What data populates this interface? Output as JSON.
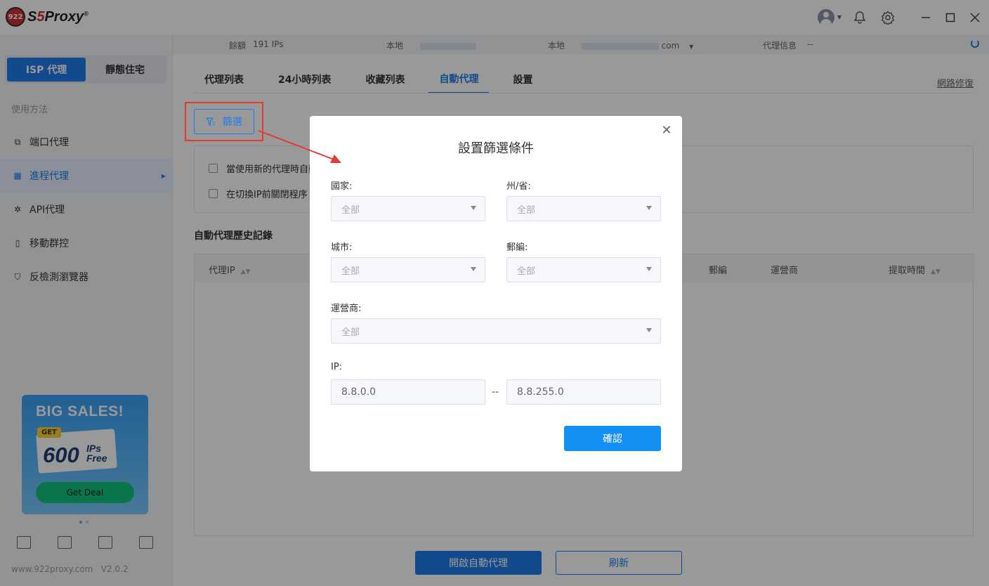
{
  "app": {
    "logo_badge": "922",
    "logo_s": "S",
    "logo_five": "5",
    "logo_rest": "Proxy",
    "logo_reg": "®"
  },
  "sidebar": {
    "type_tabs": [
      {
        "label": "ISP 代理",
        "active": true
      },
      {
        "label": "靜態住宅",
        "active": false
      }
    ],
    "section_title": "使用方法",
    "items": [
      {
        "label": "端口代理",
        "icon": "network-icon"
      },
      {
        "label": "進程代理",
        "icon": "grid-icon",
        "active": true
      },
      {
        "label": "API代理",
        "icon": "api-icon"
      },
      {
        "label": "移動群控",
        "icon": "phone-icon"
      },
      {
        "label": "反檢測瀏覽器",
        "icon": "shield-icon"
      }
    ],
    "promo": {
      "title": "BIG SALES!",
      "get": "GET",
      "number": "600",
      "ips": "IPs",
      "free": "Free",
      "cta": "Get Deal"
    },
    "footer_site": "www.922proxy.com",
    "footer_version": "V2.0.2"
  },
  "infobar": {
    "balance_label": "餘額",
    "balance_value": "191 IPs",
    "local_label": "本地",
    "local2_label": "本地",
    "account_suffix": "com",
    "proxy_info_label": "代理信息",
    "proxy_info_value": "--"
  },
  "tabs": [
    {
      "label": "代理列表"
    },
    {
      "label": "24小時列表"
    },
    {
      "label": "收藏列表"
    },
    {
      "label": "自動代理",
      "active": true
    },
    {
      "label": "設置"
    }
  ],
  "network_fix": "網路修復",
  "filter_button": "篩選",
  "options": [
    "當使用新的代理時自動",
    "在切換IP前關閉程序"
  ],
  "history_title": "自動代理歷史記錄",
  "table_headers": [
    "代理IP",
    "郵編",
    "運營商",
    "提取時間"
  ],
  "bottom_buttons": {
    "start": "開啟自動代理",
    "refresh": "刷新"
  },
  "modal": {
    "title": "設置篩選條件",
    "country_label": "國家:",
    "state_label": "州/省:",
    "city_label": "城市:",
    "zip_label": "郵編:",
    "isp_label": "運營商:",
    "ip_label": "IP:",
    "placeholder_all": "全部",
    "ip_from": "8.8.0.0",
    "ip_sep": "--",
    "ip_to": "8.8.255.0",
    "confirm": "確認",
    "close": "✕"
  },
  "colors": {
    "accent": "#1e7ce8",
    "highlight": "#e53935"
  }
}
